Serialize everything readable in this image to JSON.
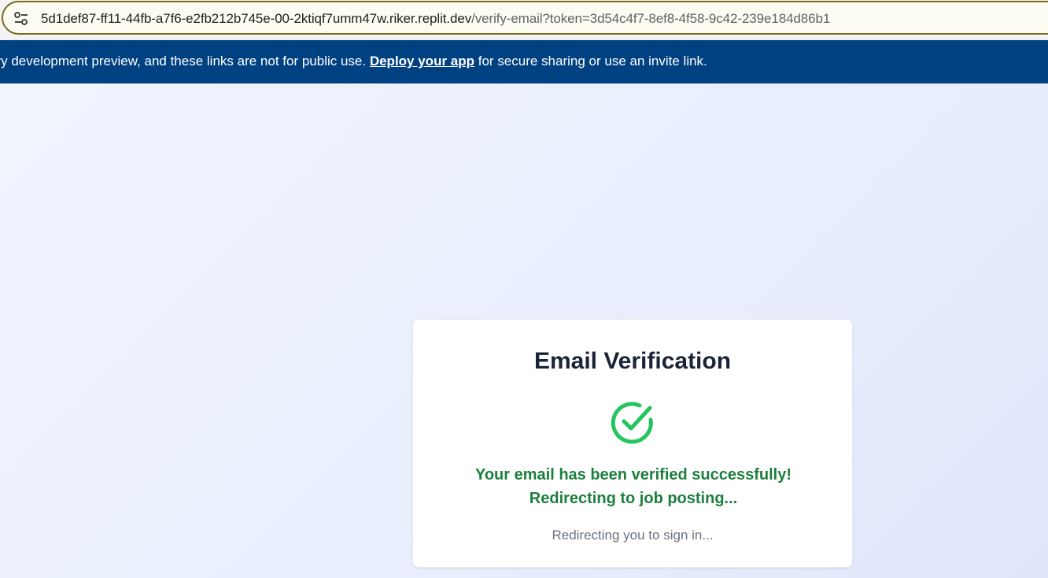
{
  "browser": {
    "url_host": "5d1def87-ff11-44fb-a7f6-e2fb212b745e-00-2ktiqf7umm47w.riker.replit.dev",
    "url_path": "/verify-email?token=3d54c4f7-8ef8-4f58-9c42-239e184d86b1",
    "site_info_icon": "tune-icon"
  },
  "banner": {
    "text_before": "ary development preview, and these links are not for public use. ",
    "link_label": "Deploy your app",
    "text_after": " for secure sharing or use an invite link.",
    "background_color": "#004182"
  },
  "card": {
    "title": "Email Verification",
    "status_icon": "check-circle-icon",
    "status_color": "#22c55e",
    "success_message": "Your email has been verified successfully! Redirecting to job posting...",
    "redirect_message": "Redirecting you to sign in..."
  }
}
